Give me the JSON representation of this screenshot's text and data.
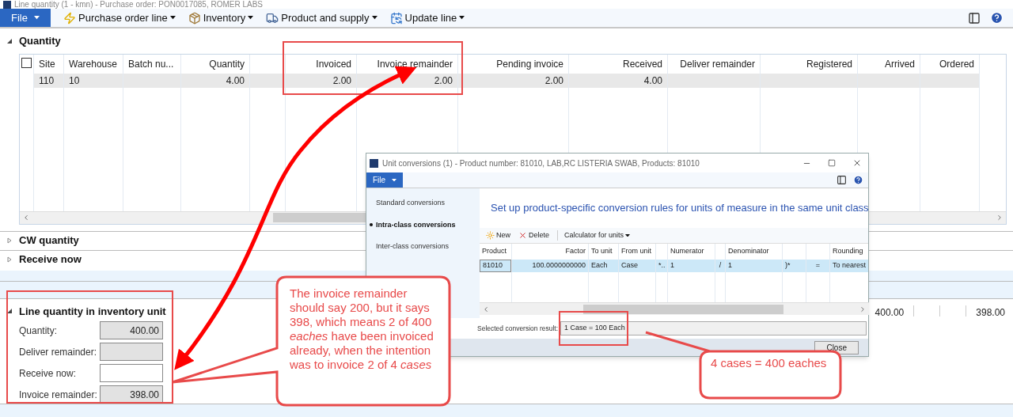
{
  "window": {
    "title": "Line quantity (1 - kmn) - Purchase order: PON0017085, ROMER LABS"
  },
  "toolbar": {
    "file_label": "File",
    "items": [
      {
        "label": "Purchase order line"
      },
      {
        "label": "Inventory"
      },
      {
        "label": "Product and supply"
      },
      {
        "label": "Update line"
      }
    ]
  },
  "quantity_section": {
    "title": "Quantity",
    "expanded": true,
    "columns": [
      "Site",
      "Warehouse",
      "Batch nu...",
      "Quantity",
      null,
      "Invoiced",
      "Invoice remainder",
      "Pending invoice",
      "Received",
      "Deliver remainder",
      "Registered",
      "Arrived",
      "Ordered"
    ],
    "select_all_checked": false,
    "rows": [
      {
        "selected": true,
        "cells": [
          "110",
          "10",
          null,
          "4.00",
          null,
          "2.00",
          "2.00",
          "2.00",
          "4.00",
          null,
          null,
          null,
          null
        ]
      }
    ]
  },
  "collapsed_sections": [
    {
      "title": "CW quantity",
      "expanded": false
    },
    {
      "title": "Receive now",
      "expanded": false
    }
  ],
  "inventory_section": {
    "title": "Line quantity in inventory unit",
    "expanded": true,
    "fields": [
      {
        "label": "Quantity:",
        "value": "400.00",
        "readonly": true
      },
      {
        "label": "Deliver remainder:",
        "readonly": true
      },
      {
        "label": "Receive now:",
        "readonly": false
      },
      {
        "label": "Invoice remainder:",
        "value": "398.00",
        "readonly": true
      }
    ],
    "right_values": [
      "400.00",
      "398.00"
    ]
  },
  "dialog": {
    "title": "Unit conversions (1) - Product number: 81010, LAB,RC LISTERIA SWAB, Products: 81010",
    "file_label": "File",
    "nav": [
      {
        "label": "Standard conversions",
        "selected": false
      },
      {
        "label": "Intra-class conversions",
        "selected": true
      },
      {
        "label": "Inter-class conversions",
        "selected": false
      }
    ],
    "heading": "Set up product-specific conversion rules for units of measure in the same unit class",
    "actions": [
      {
        "label": "New"
      },
      {
        "label": "Delete"
      },
      {
        "label": "Calculator for units"
      }
    ],
    "columns": [
      "Product",
      "Factor",
      "To unit",
      "From unit",
      null,
      "Numerator",
      null,
      "Denominator",
      null,
      null,
      "Rounding"
    ],
    "rows": [
      {
        "selected": true,
        "cells": [
          "81010",
          "100.0000000000",
          "Each",
          "Case",
          "*..",
          "1",
          "/",
          "1",
          ")*",
          "=",
          "To nearest"
        ]
      }
    ],
    "result_label": "Selected conversion result:",
    "result_value": "1 Case = 100 Each",
    "close_label": "Close"
  },
  "callouts": [
    {
      "text": "The invoice remainder should say 200, but it says 398, which means 2 of 400 *eaches* have been invoiced already, when the intention was to invoice 2 of 4 *cases*"
    },
    {
      "text": "4 cases = 400 eaches"
    }
  ]
}
